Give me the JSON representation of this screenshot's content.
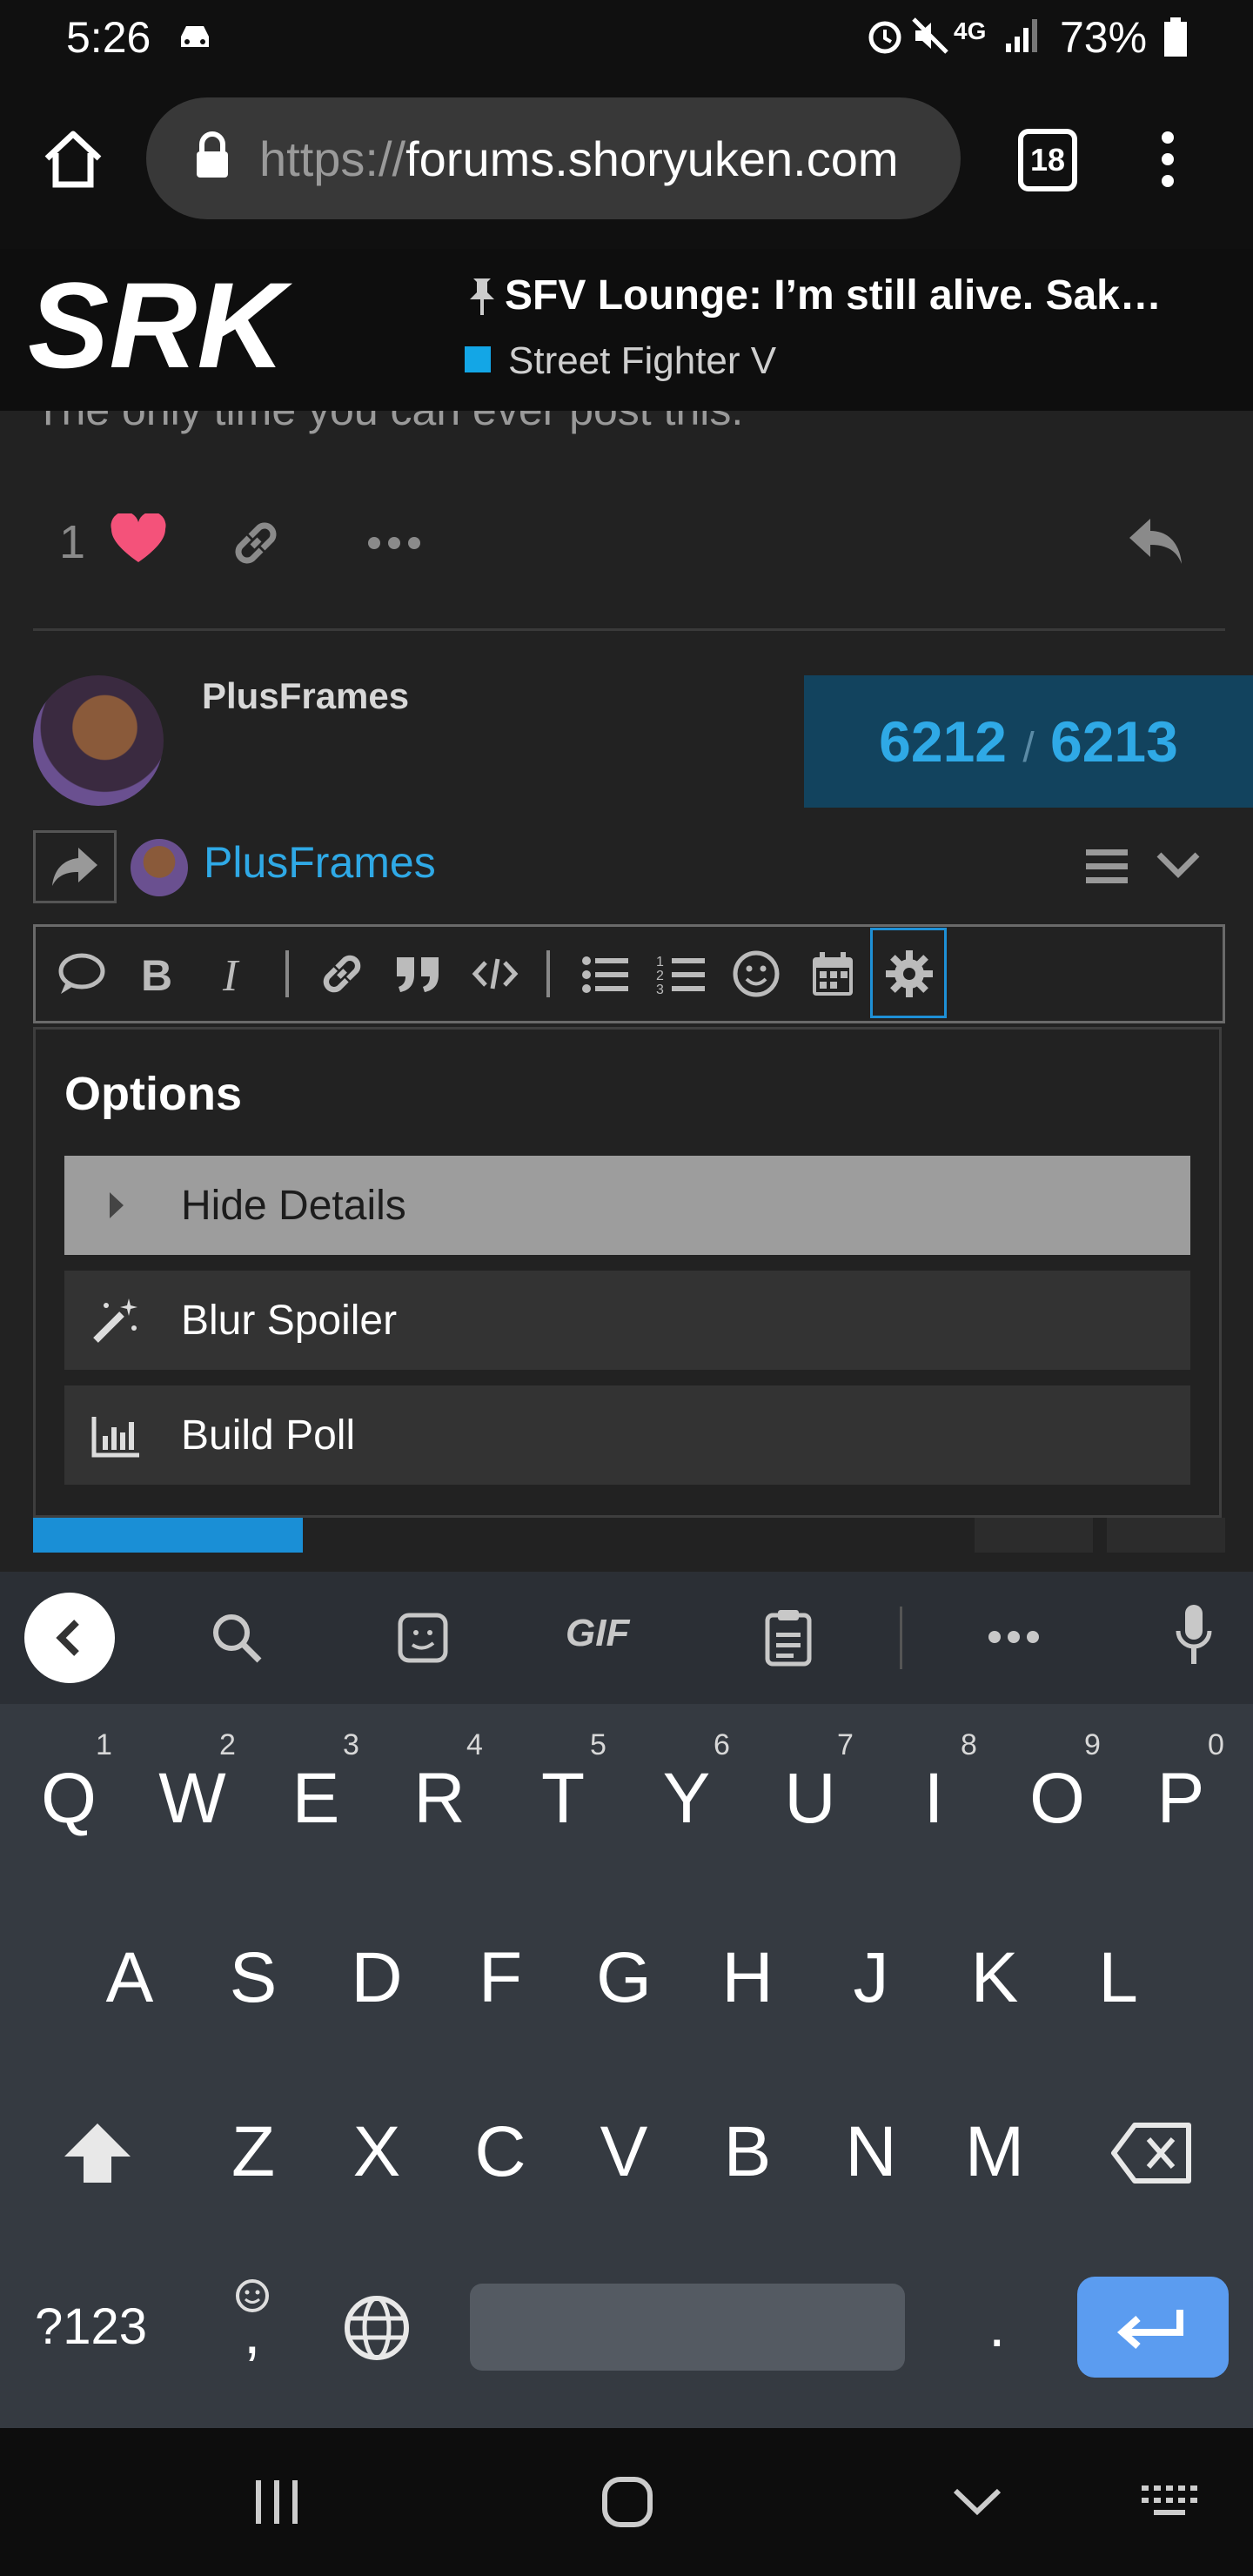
{
  "status_bar": {
    "time": "5:26",
    "battery": "73%"
  },
  "browser": {
    "url_prefix": "https://",
    "url_domain": "forums.shoryuken.com",
    "tab_count": "18"
  },
  "forum": {
    "logo": "SRK",
    "topic_title": "SFV Lounge: I’m still alive. Sak…",
    "category": "Street Fighter V"
  },
  "post": {
    "snippet": "The only time you can ever post this.",
    "like_count": "1",
    "poster_name": "PlusFrames",
    "progress_current": "6212",
    "progress_separator": "/",
    "progress_total": "6213"
  },
  "composer": {
    "reply_to_user": "PlusFrames"
  },
  "options": {
    "title": "Options",
    "items": [
      {
        "label": "Hide Details",
        "icon": "caret-right-icon"
      },
      {
        "label": "Blur Spoiler",
        "icon": "magic-wand-icon"
      },
      {
        "label": "Build Poll",
        "icon": "bar-chart-icon"
      }
    ]
  },
  "keyboard": {
    "row1": [
      "Q",
      "W",
      "E",
      "R",
      "T",
      "Y",
      "U",
      "I",
      "O",
      "P"
    ],
    "row1_hints": [
      "1",
      "2",
      "3",
      "4",
      "5",
      "6",
      "7",
      "8",
      "9",
      "0"
    ],
    "row2": [
      "A",
      "S",
      "D",
      "F",
      "G",
      "H",
      "J",
      "K",
      "L"
    ],
    "row3": [
      "Z",
      "X",
      "C",
      "V",
      "B",
      "N",
      "M"
    ],
    "symbols_key": "?123",
    "comma_key": ",",
    "period_key": ".",
    "gif_label": "GIF"
  },
  "colors": {
    "accent_blue": "#2fa9e6",
    "like_heart": "#f4527a",
    "enter_key": "#5b9cf0"
  }
}
